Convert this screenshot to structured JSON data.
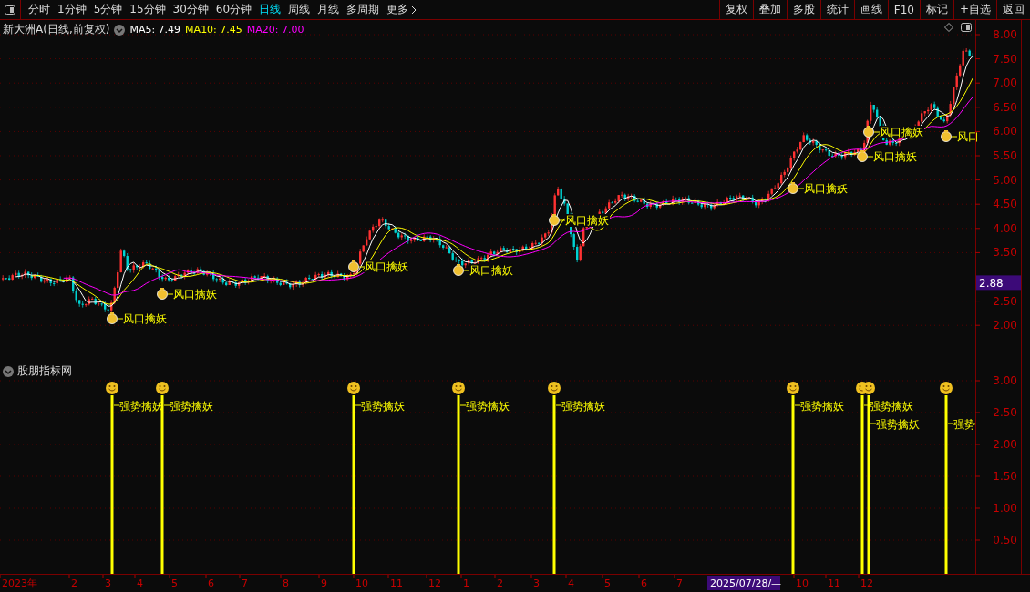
{
  "toolbar": {
    "periods": [
      {
        "label": "分时",
        "selected": false
      },
      {
        "label": "1分钟",
        "selected": false
      },
      {
        "label": "5分钟",
        "selected": false
      },
      {
        "label": "15分钟",
        "selected": false
      },
      {
        "label": "30分钟",
        "selected": false
      },
      {
        "label": "60分钟",
        "selected": false
      },
      {
        "label": "日线",
        "selected": true
      },
      {
        "label": "周线",
        "selected": false
      },
      {
        "label": "月线",
        "selected": false
      },
      {
        "label": "多周期",
        "selected": false
      },
      {
        "label": "更多",
        "selected": false
      }
    ],
    "actions": [
      "复权",
      "叠加",
      "多股",
      "统计",
      "画线",
      "F10",
      "标记",
      "+自选",
      "返回"
    ]
  },
  "chart": {
    "title": "新大洲A(日线,前复权)",
    "ma": [
      {
        "label": "MA5: 7.49",
        "color": "#ffffff"
      },
      {
        "label": "MA10: 7.45",
        "color": "#ffff00"
      },
      {
        "label": "MA20: 7.00",
        "color": "#ff00ff"
      }
    ],
    "price_axis": [
      "8.00",
      "7.50",
      "7.00",
      "6.50",
      "6.00",
      "5.50",
      "5.00",
      "4.50",
      "4.00",
      "3.50",
      "2.50",
      "2.00"
    ],
    "current_price": "2.88",
    "signals": [
      {
        "label": "风口擒妖"
      },
      {
        "label": "风口擒妖"
      },
      {
        "label": "风口擒妖"
      },
      {
        "label": "风口擒妖"
      },
      {
        "label": "风口擒妖"
      },
      {
        "label": "风口擒妖"
      },
      {
        "label": "风口擒妖"
      },
      {
        "label": "风口擒妖"
      },
      {
        "label": "风口"
      }
    ]
  },
  "indicator": {
    "title": "股朋指标网",
    "axis": [
      "3.00",
      "2.50",
      "2.00",
      "1.50",
      "1.00",
      "0.50"
    ],
    "signals": [
      {
        "label": "强势擒妖"
      },
      {
        "label": "强势擒妖"
      },
      {
        "label": "强势擒妖"
      },
      {
        "label": "强势擒妖"
      },
      {
        "label": "强势擒妖"
      },
      {
        "label": "强势擒妖"
      },
      {
        "label": "强势擒妖"
      },
      {
        "label": "强势擒妖"
      },
      {
        "label": "强势"
      }
    ]
  },
  "time_axis": {
    "labels": [
      "2023年",
      "2",
      "3",
      "4",
      "5",
      "6",
      "7",
      "8",
      "9",
      "10",
      "11",
      "12",
      "1",
      "2",
      "3",
      "4",
      "5",
      "6",
      "7",
      "10",
      "11",
      "12"
    ],
    "cursor_date": "2025/07/28/—"
  }
}
